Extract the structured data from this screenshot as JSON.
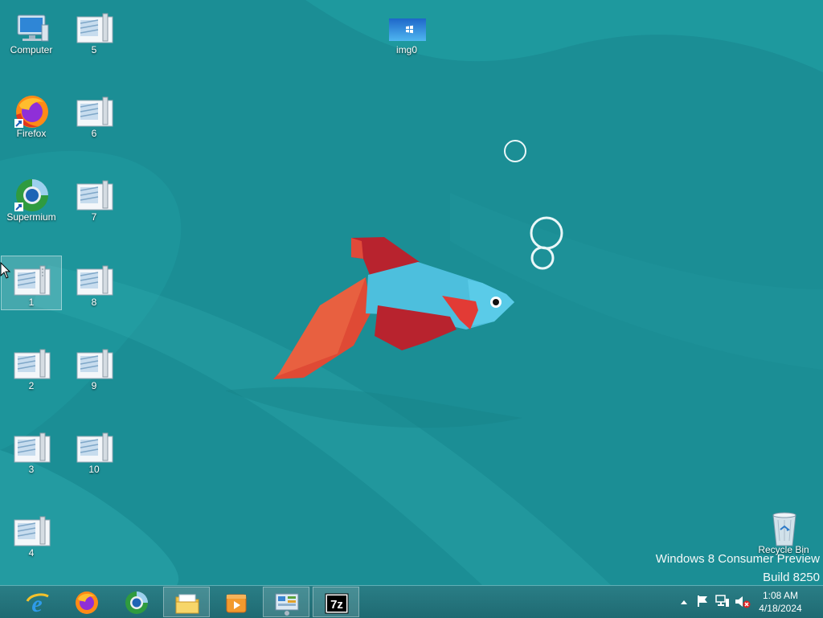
{
  "desktop": {
    "icons": [
      {
        "label": "Computer",
        "icon": "computer-icon"
      },
      {
        "label": "Firefox",
        "icon": "firefox-icon"
      },
      {
        "label": "Supermium",
        "icon": "supermium-icon"
      },
      {
        "label": "1",
        "icon": "file-icon"
      },
      {
        "label": "2",
        "icon": "file-icon"
      },
      {
        "label": "3",
        "icon": "file-icon"
      },
      {
        "label": "4",
        "icon": "file-icon"
      },
      {
        "label": "5",
        "icon": "file-icon"
      },
      {
        "label": "6",
        "icon": "file-icon"
      },
      {
        "label": "7",
        "icon": "file-icon"
      },
      {
        "label": "8",
        "icon": "file-icon"
      },
      {
        "label": "9",
        "icon": "file-icon"
      },
      {
        "label": "10",
        "icon": "file-icon"
      },
      {
        "label": "img0",
        "icon": "image-file-icon"
      },
      {
        "label": "Recycle Bin",
        "icon": "recycle-bin-icon"
      }
    ],
    "watermark": {
      "line1": "Windows 8 Consumer Preview",
      "line2": "Build 8250"
    }
  },
  "taskbar": {
    "buttons": [
      {
        "name": "internet-explorer-button",
        "icon": "internet-explorer-icon",
        "open": false
      },
      {
        "name": "firefox-taskbar-button",
        "icon": "firefox-icon",
        "open": false
      },
      {
        "name": "supermium-taskbar-button",
        "icon": "supermium-icon",
        "open": false
      },
      {
        "name": "file-explorer-button",
        "icon": "folder-icon",
        "open": true
      },
      {
        "name": "media-player-button",
        "icon": "media-player-icon",
        "open": false
      },
      {
        "name": "control-panel-button",
        "icon": "control-panel-icon",
        "open": true
      },
      {
        "name": "7zip-button",
        "icon": "7zip-icon",
        "label": "7z",
        "open": true
      }
    ],
    "tray": {
      "icons": [
        "show-hidden-icons-icon",
        "action-center-flag-icon",
        "network-icon",
        "volume-muted-icon"
      ],
      "time": "1:08 AM",
      "date": "4/18/2024"
    }
  },
  "colors": {
    "background": "#1b8e95",
    "taskbar": "#237580",
    "fish_body": "#4dbfdd",
    "fish_fin": "#c42a32",
    "fish_tail": "#df4a35"
  }
}
